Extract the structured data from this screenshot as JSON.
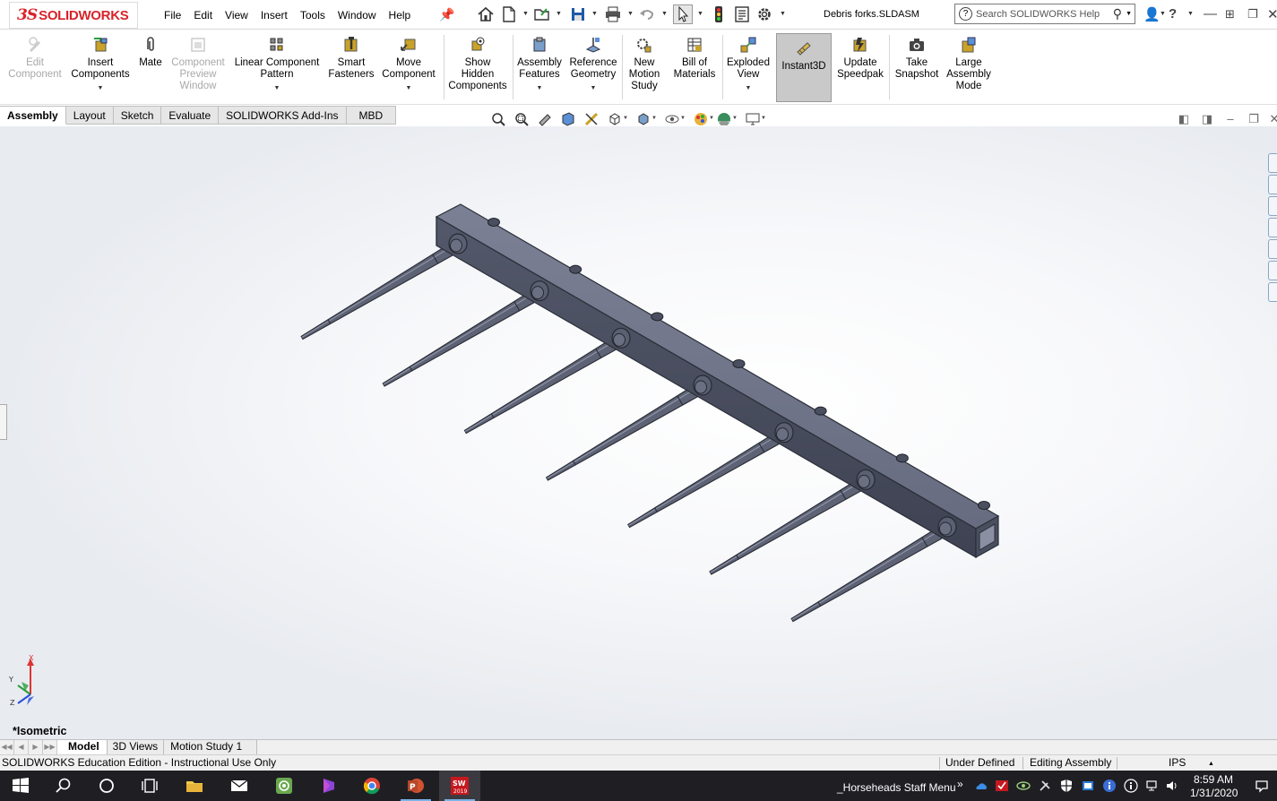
{
  "app": {
    "logo_ds": "3S",
    "logo_name": "SOLIDWORKS",
    "document_title": "Debris forks.SLDASM",
    "search_placeholder": "Search SOLIDWORKS Help"
  },
  "menu": [
    "File",
    "Edit",
    "View",
    "Insert",
    "Tools",
    "Window",
    "Help"
  ],
  "commands": [
    {
      "id": "edit-component",
      "label": [
        "Edit",
        "Component"
      ],
      "enabled": false,
      "icon": "edit-component-icon"
    },
    {
      "id": "insert-components",
      "label": [
        "Insert",
        "Components"
      ],
      "enabled": true,
      "icon": "insert-components-icon",
      "dropdown": true
    },
    {
      "id": "mate",
      "label": [
        "Mate"
      ],
      "enabled": true,
      "icon": "mate-paperclip-icon"
    },
    {
      "id": "component-preview-window",
      "label": [
        "Component",
        "Preview",
        "Window"
      ],
      "enabled": false,
      "icon": "preview-window-icon"
    },
    {
      "id": "linear-component-pattern",
      "label": [
        "Linear Component",
        "Pattern"
      ],
      "enabled": true,
      "icon": "linear-pattern-icon",
      "dropdown": true
    },
    {
      "id": "smart-fasteners",
      "label": [
        "Smart",
        "Fasteners"
      ],
      "enabled": true,
      "icon": "smart-fasteners-icon"
    },
    {
      "id": "move-component",
      "label": [
        "Move",
        "Component"
      ],
      "enabled": true,
      "icon": "move-component-icon",
      "dropdown": true
    },
    {
      "id": "show-hidden-components",
      "label": [
        "Show",
        "Hidden",
        "Components"
      ],
      "enabled": true,
      "icon": "show-hidden-icon"
    },
    {
      "id": "assembly-features",
      "label": [
        "Assembly",
        "Features"
      ],
      "enabled": true,
      "icon": "assembly-features-icon",
      "dropdown": true
    },
    {
      "id": "reference-geometry",
      "label": [
        "Reference",
        "Geometry"
      ],
      "enabled": true,
      "icon": "reference-geometry-icon",
      "dropdown": true
    },
    {
      "id": "new-motion-study",
      "label": [
        "New",
        "Motion",
        "Study"
      ],
      "enabled": true,
      "icon": "motion-study-icon"
    },
    {
      "id": "bill-of-materials",
      "label": [
        "Bill of",
        "Materials"
      ],
      "enabled": true,
      "icon": "bom-icon"
    },
    {
      "id": "exploded-view",
      "label": [
        "Exploded",
        "View"
      ],
      "enabled": true,
      "icon": "exploded-view-icon",
      "dropdown": true
    },
    {
      "id": "instant3d",
      "label": [
        "Instant3D"
      ],
      "enabled": true,
      "active": true,
      "icon": "instant3d-icon"
    },
    {
      "id": "update-speedpak",
      "label": [
        "Update",
        "Speedpak"
      ],
      "enabled": true,
      "icon": "speedpak-icon"
    },
    {
      "id": "take-snapshot",
      "label": [
        "Take",
        "Snapshot"
      ],
      "enabled": true,
      "icon": "camera-icon"
    },
    {
      "id": "large-assembly-mode",
      "label": [
        "Large",
        "Assembly",
        "Mode"
      ],
      "enabled": true,
      "icon": "large-assembly-icon"
    }
  ],
  "tabs": [
    {
      "label": "Assembly",
      "active": true
    },
    {
      "label": "Layout",
      "active": false
    },
    {
      "label": "Sketch",
      "active": false
    },
    {
      "label": "Evaluate",
      "active": false
    },
    {
      "label": "SOLIDWORKS Add-Ins",
      "active": false
    },
    {
      "label": "MBD",
      "active": false
    }
  ],
  "viewport": {
    "view_name": "*Isometric",
    "triad": {
      "x": "X",
      "y": "Y",
      "z": "Z"
    }
  },
  "bottom_tabs": [
    {
      "label": "Model",
      "active": true
    },
    {
      "label": "3D Views",
      "active": false
    },
    {
      "label": "Motion Study 1",
      "active": false
    }
  ],
  "status": {
    "edition": "SOLIDWORKS Education Edition - Instructional Use Only",
    "definition": "Under Defined",
    "mode": "Editing Assembly",
    "units": "IPS"
  },
  "taskbar": {
    "toolbar_label": "_Horseheads Staff Menu",
    "time": "8:59 AM",
    "date": "1/31/2020",
    "sw_badge": "SW",
    "sw_year": "2019"
  },
  "colors": {
    "brand_red": "#d8232a",
    "model_steel": "#5d6274",
    "taskbar": "#1f1f23"
  }
}
